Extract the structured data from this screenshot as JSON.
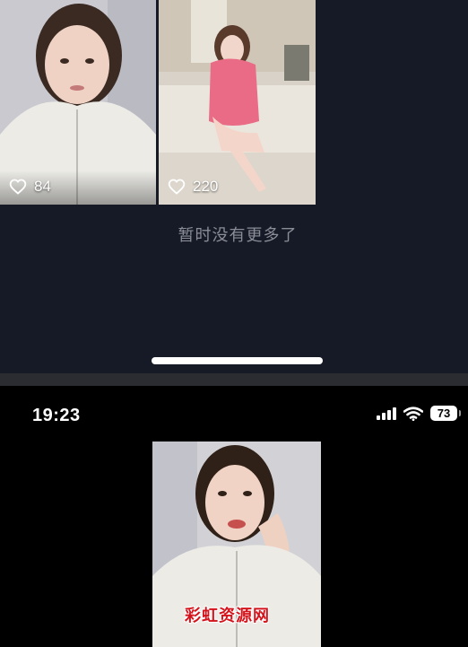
{
  "feed": {
    "posts": [
      {
        "likes": "84",
        "photo": "selfie-white-jacket"
      },
      {
        "likes": "220",
        "photo": "pink-dress-on-sofa"
      }
    ],
    "end_message": "暂时没有更多了"
  },
  "status_bar": {
    "time": "19:23",
    "battery": "73",
    "icons": [
      "cellular-signal-icon",
      "wifi-icon",
      "battery-icon"
    ]
  },
  "video": {
    "photo": "selfie-white-jacket-hand-on-chin",
    "watermark": "彩虹资源网"
  },
  "colors": {
    "feed_background": "#161a26",
    "muted_text": "#8a8d96",
    "watermark": "#d4141c"
  }
}
